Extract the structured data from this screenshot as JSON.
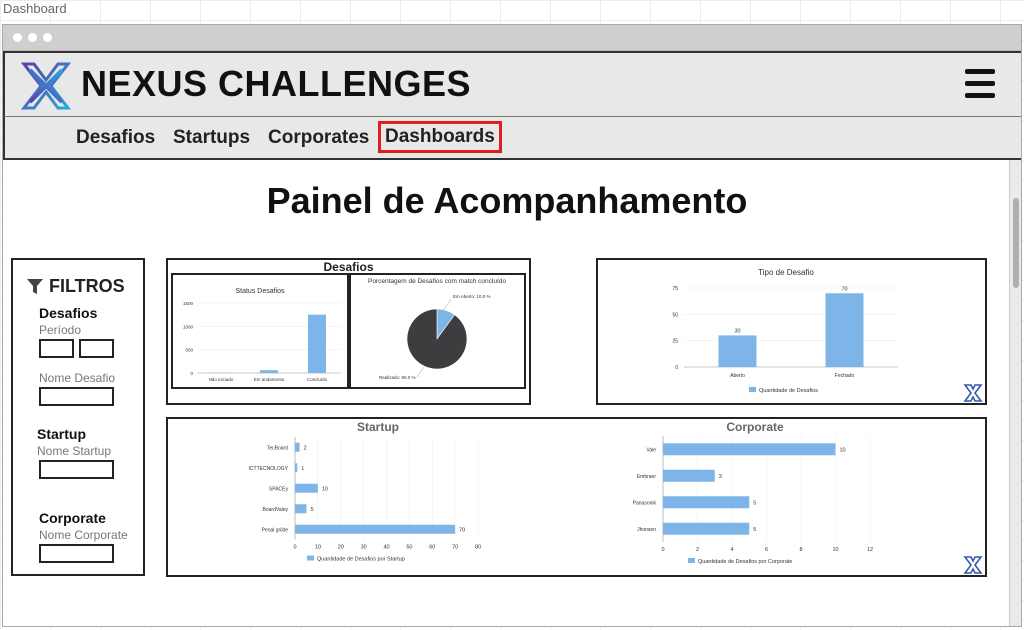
{
  "page_label": "Dashboard",
  "brand": {
    "name": "NEXUS CHALLENGES"
  },
  "colors": {
    "accent": "#7eb5e8",
    "pie_dark": "#3d3d40",
    "highlight": "#e02020"
  },
  "nav": [
    {
      "label": "Desafios",
      "active": false
    },
    {
      "label": "Startups",
      "active": false
    },
    {
      "label": "Corporates",
      "active": false
    },
    {
      "label": "Dashboards",
      "active": true
    }
  ],
  "main": {
    "title": "Painel de Acompanhamento"
  },
  "filters": {
    "title": "FILTROS",
    "desafios": {
      "heading": "Desafios",
      "period_label": "Período",
      "name_label": "Nome Desafio"
    },
    "startup": {
      "heading": "Startup",
      "name_label": "Nome Startup"
    },
    "corporate": {
      "heading": "Corporate",
      "name_label": "Nome Corporate"
    }
  },
  "desafios_panel": {
    "title": "Desafios"
  },
  "startup_panel": {
    "title": "Startup"
  },
  "corporate_panel": {
    "title": "Corporate"
  },
  "chart_data": [
    {
      "id": "status-desafios",
      "type": "bar",
      "title": "Status Desafios",
      "categories": [
        "Não iniciado",
        "Em andamento",
        "Concluído"
      ],
      "values": [
        5,
        60,
        1250
      ],
      "ylim": [
        0,
        1500
      ],
      "yticks": [
        "0",
        "500",
        "1000",
        "1500"
      ]
    },
    {
      "id": "match-concluido",
      "type": "pie",
      "title": "Porcentagem de Desafios com match concluído",
      "slices": [
        {
          "label": "Em Aberto: 10.0 %",
          "value": 10.0
        },
        {
          "label": "Realizado: 90.0 %",
          "value": 90.0
        }
      ]
    },
    {
      "id": "tipo-desafio",
      "type": "bar",
      "title": "Tipo de Desafio",
      "categories": [
        "Aberto",
        "Fechado"
      ],
      "values": [
        30,
        70
      ],
      "ylim": [
        0,
        75
      ],
      "yticks": [
        "0",
        "25",
        "50",
        "75"
      ],
      "legend": "Quantidade de Desafios"
    },
    {
      "id": "startup-bars",
      "type": "bar",
      "orientation": "horizontal",
      "categories": [
        "TecBoard",
        "ICTTECNOLOGY",
        "SPACEy",
        "BoardValey",
        "Penal grilde"
      ],
      "values": [
        2,
        1,
        10,
        5,
        70
      ],
      "xlim": [
        0,
        80
      ],
      "xticks": [
        "0",
        "10",
        "20",
        "30",
        "40",
        "50",
        "60",
        "70",
        "80"
      ],
      "legend": "Quantidade de Desafios por Startup"
    },
    {
      "id": "corporate-bars",
      "type": "bar",
      "orientation": "horizontal",
      "categories": [
        "Vale",
        "Embraer",
        "Panasonik",
        "Jhonsen"
      ],
      "values": [
        10,
        3,
        5,
        5
      ],
      "xlim": [
        0,
        12
      ],
      "xticks": [
        "0",
        "2",
        "4",
        "6",
        "8",
        "10",
        "12"
      ],
      "legend": "Quantidade de Desafios por Corporate"
    }
  ]
}
